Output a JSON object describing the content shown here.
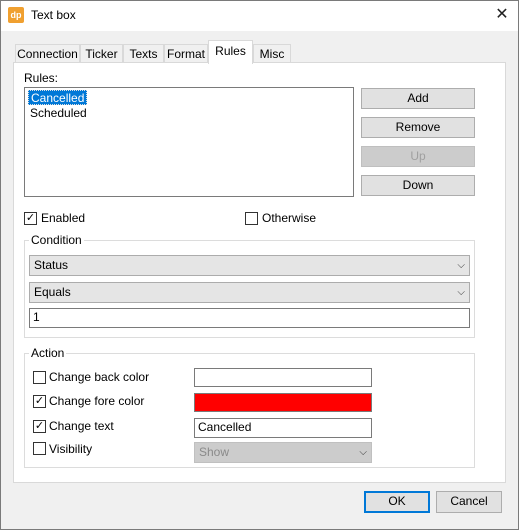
{
  "window": {
    "title": "Text box",
    "icon_text": "dp"
  },
  "tabs": [
    "Connection",
    "Ticker",
    "Texts",
    "Format",
    "Rules",
    "Misc"
  ],
  "rules": {
    "label": "Rules:",
    "items": [
      "Cancelled",
      "Scheduled"
    ],
    "selected": "Cancelled",
    "buttons": {
      "add": "Add",
      "remove": "Remove",
      "up": "Up",
      "down": "Down"
    }
  },
  "enabled": {
    "label": "Enabled",
    "checked": true
  },
  "otherwise": {
    "label": "Otherwise",
    "checked": false
  },
  "condition": {
    "title": "Condition",
    "field": "Status",
    "operator": "Equals",
    "value": "1"
  },
  "action": {
    "title": "Action",
    "back_color": {
      "label": "Change back color",
      "checked": false,
      "color": "#ffffff"
    },
    "fore_color": {
      "label": "Change fore color",
      "checked": true,
      "color": "#ff0000"
    },
    "text": {
      "label": "Change text",
      "checked": true,
      "value": "Cancelled"
    },
    "visibility": {
      "label": "Visibility",
      "checked": false,
      "value": "Show"
    }
  },
  "footer": {
    "ok": "OK",
    "cancel": "Cancel"
  }
}
